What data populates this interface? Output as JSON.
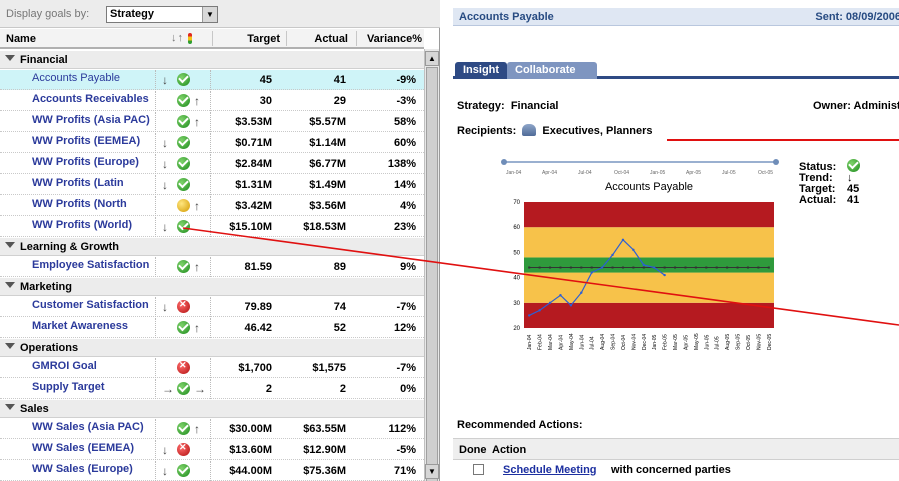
{
  "filter": {
    "label": "Display goals by:",
    "value": "Strategy"
  },
  "grid": {
    "headers": {
      "name": "Name",
      "target": "Target",
      "actual": "Actual",
      "variance": "Variance%"
    },
    "groups": [
      {
        "label": "Financial",
        "rows": [
          {
            "name": "Accounts Payable",
            "left_trend": "down",
            "status": "ok",
            "right_trend": "",
            "target": "45",
            "actual": "41",
            "variance": "-9%",
            "selected": true
          },
          {
            "name": "Accounts Receivables",
            "left_trend": "",
            "status": "ok",
            "right_trend": "up",
            "target": "30",
            "actual": "29",
            "variance": "-3%"
          },
          {
            "name": "WW Profits (Asia PAC)",
            "left_trend": "",
            "status": "ok",
            "right_trend": "up",
            "target": "$3.53M",
            "actual": "$5.57M",
            "variance": "58%"
          },
          {
            "name": "WW Profits (EEMEA)",
            "left_trend": "down",
            "status": "ok",
            "right_trend": "",
            "target": "$0.71M",
            "actual": "$1.14M",
            "variance": "60%"
          },
          {
            "name": "WW Profits (Europe)",
            "left_trend": "down",
            "status": "ok",
            "right_trend": "",
            "target": "$2.84M",
            "actual": "$6.77M",
            "variance": "138%"
          },
          {
            "name": "WW Profits (Latin",
            "left_trend": "down",
            "status": "ok",
            "right_trend": "",
            "target": "$1.31M",
            "actual": "$1.49M",
            "variance": "14%"
          },
          {
            "name": "WW Profits (North",
            "left_trend": "",
            "status": "warn",
            "right_trend": "up",
            "target": "$3.42M",
            "actual": "$3.56M",
            "variance": "4%"
          },
          {
            "name": "WW Profits (World)",
            "left_trend": "down",
            "status": "ok",
            "right_trend": "",
            "target": "$15.10M",
            "actual": "$18.53M",
            "variance": "23%"
          }
        ]
      },
      {
        "label": "Learning & Growth",
        "rows": [
          {
            "name": "Employee Satisfaction",
            "left_trend": "",
            "status": "ok",
            "right_trend": "up",
            "target": "81.59",
            "actual": "89",
            "variance": "9%"
          }
        ]
      },
      {
        "label": "Marketing",
        "rows": [
          {
            "name": "Customer Satisfaction",
            "left_trend": "down",
            "status": "bad",
            "right_trend": "",
            "target": "79.89",
            "actual": "74",
            "variance": "-7%"
          },
          {
            "name": "Market Awareness",
            "left_trend": "",
            "status": "ok",
            "right_trend": "up",
            "target": "46.42",
            "actual": "52",
            "variance": "12%"
          }
        ]
      },
      {
        "label": "Operations",
        "rows": [
          {
            "name": "GMROI Goal",
            "left_trend": "",
            "status": "bad",
            "right_trend": "",
            "target": "$1,700",
            "actual": "$1,575",
            "variance": "-7%"
          },
          {
            "name": "Supply Target",
            "left_trend": "right",
            "status": "ok",
            "right_trend": "right",
            "target": "2",
            "actual": "2",
            "variance": "0%"
          }
        ]
      },
      {
        "label": "Sales",
        "rows": [
          {
            "name": "WW Sales (Asia PAC)",
            "left_trend": "",
            "status": "ok",
            "right_trend": "up",
            "target": "$30.00M",
            "actual": "$63.55M",
            "variance": "112%"
          },
          {
            "name": "WW Sales (EEMEA)",
            "left_trend": "down",
            "status": "bad",
            "right_trend": "",
            "target": "$13.60M",
            "actual": "$12.90M",
            "variance": "-5%"
          },
          {
            "name": "WW Sales (Europe)",
            "left_trend": "down",
            "status": "ok",
            "right_trend": "",
            "target": "$44.00M",
            "actual": "$75.36M",
            "variance": "71%"
          }
        ]
      }
    ]
  },
  "detail": {
    "title": "Accounts Payable",
    "sent": "Sent: 08/09/2006",
    "tabs": [
      "Insight",
      "Collaborate"
    ],
    "strategy_label": "Strategy:",
    "strategy_value": "Financial",
    "owner": "Owner: Administrator",
    "recipients_label": "Recipients:",
    "recipients_value": "Executives, Planners",
    "status": {
      "status_label": "Status:",
      "trend_label": "Trend:",
      "target_label": "Target:",
      "target_value": "45",
      "actual_label": "Actual:",
      "actual_value": "41"
    },
    "recommended_label": "Recommended Actions:",
    "actions_header": {
      "done": "Done",
      "action": "Action"
    },
    "action": {
      "link": "Schedule Meeting",
      "rest": "with concerned parties"
    }
  },
  "chart_data": {
    "type": "line",
    "title": "Accounts Payable",
    "slider_labels": [
      "Jan-04",
      "Apr-04",
      "Jul-04",
      "Oct-04",
      "Jan-05",
      "Apr-05",
      "Jul-05",
      "Oct-05"
    ],
    "categories": [
      "Jan-04",
      "Feb-04",
      "Mar-04",
      "Apr-04",
      "May-04",
      "Jun-04",
      "Jul-04",
      "Aug-04",
      "Sep-04",
      "Oct-04",
      "Nov-04",
      "Dec-04",
      "Jan-05",
      "Feb-05",
      "Mar-05",
      "Apr-05",
      "May-05",
      "Jun-05",
      "Jul-05",
      "Aug-05",
      "Sep-05",
      "Oct-05",
      "Nov-05",
      "Dec-05"
    ],
    "series": [
      {
        "values": [
          25,
          27,
          30,
          33,
          29,
          34,
          42,
          44,
          49,
          55,
          51,
          45,
          44,
          41,
          null,
          null,
          null,
          null,
          null,
          null,
          null,
          null,
          null,
          null
        ]
      },
      {
        "values": [
          44,
          44,
          44,
          44,
          44,
          44,
          44,
          44,
          44,
          44,
          44,
          44,
          44,
          44,
          44,
          44,
          44,
          44,
          44,
          44,
          44,
          44,
          44,
          44
        ]
      }
    ],
    "bands": [
      {
        "from": 0,
        "to": 30,
        "color": "#b51a20"
      },
      {
        "from": 30,
        "to": 42,
        "color": "#f7c24a"
      },
      {
        "from": 42,
        "to": 48,
        "color": "#2f9a3c"
      },
      {
        "from": 48,
        "to": 60,
        "color": "#f7c24a"
      },
      {
        "from": 60,
        "to": 70,
        "color": "#b51a20"
      }
    ],
    "yticks": [
      20,
      30,
      40,
      50,
      60,
      70
    ],
    "ylim": [
      20,
      70
    ],
    "line_color": "#2b5fd6",
    "target_color": "#333333"
  }
}
